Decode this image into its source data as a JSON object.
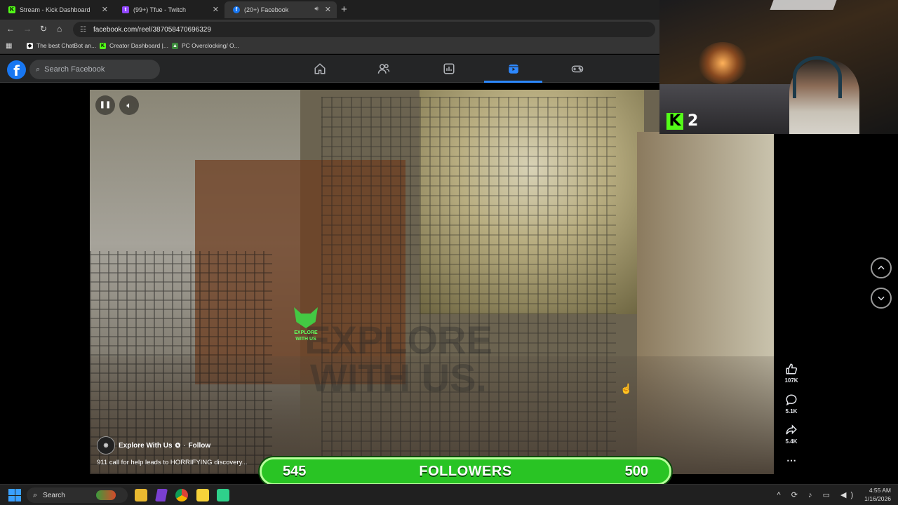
{
  "browser": {
    "tabs": [
      {
        "label": "Stream - Kick Dashboard",
        "icon": "kick-icon",
        "color": "#53fc18"
      },
      {
        "label": "(99+) Tfue - Twitch",
        "icon": "twitch-icon",
        "color": "#9146ff"
      },
      {
        "label": "(20+) Facebook",
        "icon": "facebook-icon",
        "color": "#1877f2",
        "active": true
      }
    ],
    "url": "facebook.com/reel/387058470696329",
    "bookmarks": [
      {
        "label": "The best ChatBot an...",
        "icon": "chatbot-icon"
      },
      {
        "label": "Creator Dashboard |...",
        "icon": "kick-icon"
      },
      {
        "label": "PC Overclocking/ O...",
        "icon": "overclock-icon"
      }
    ]
  },
  "facebook": {
    "logo": "f",
    "search_placeholder": "Search Facebook",
    "nav": [
      {
        "name": "home",
        "icon": "home-icon"
      },
      {
        "name": "friends",
        "icon": "friends-icon"
      },
      {
        "name": "dashboard",
        "icon": "dashboard-icon"
      },
      {
        "name": "reels",
        "icon": "reels-icon",
        "active": true
      },
      {
        "name": "gaming",
        "icon": "gaming-icon"
      }
    ],
    "accent": "#2d88ff"
  },
  "reel": {
    "author": "Explore With Us",
    "verified": true,
    "follow_label": "Follow",
    "caption": "911 call for help leads to HORRIFYING discovery...",
    "watermark_line1": "EXPLORE",
    "watermark_line2": "WITH US.",
    "badge_line1": "EXPLORE",
    "badge_line2": "WITH US",
    "likes": "107K",
    "comments": "5.1K",
    "shares": "5.4K"
  },
  "overlay": {
    "kick_logo": "K",
    "kick_count": "2",
    "followers_current": "545",
    "followers_label": "FOLLOWERS",
    "followers_goal": "500",
    "bar_color": "#29c424"
  },
  "taskbar": {
    "search_label": "Search",
    "time": "4:55 AM",
    "date": "1/16/2026"
  }
}
